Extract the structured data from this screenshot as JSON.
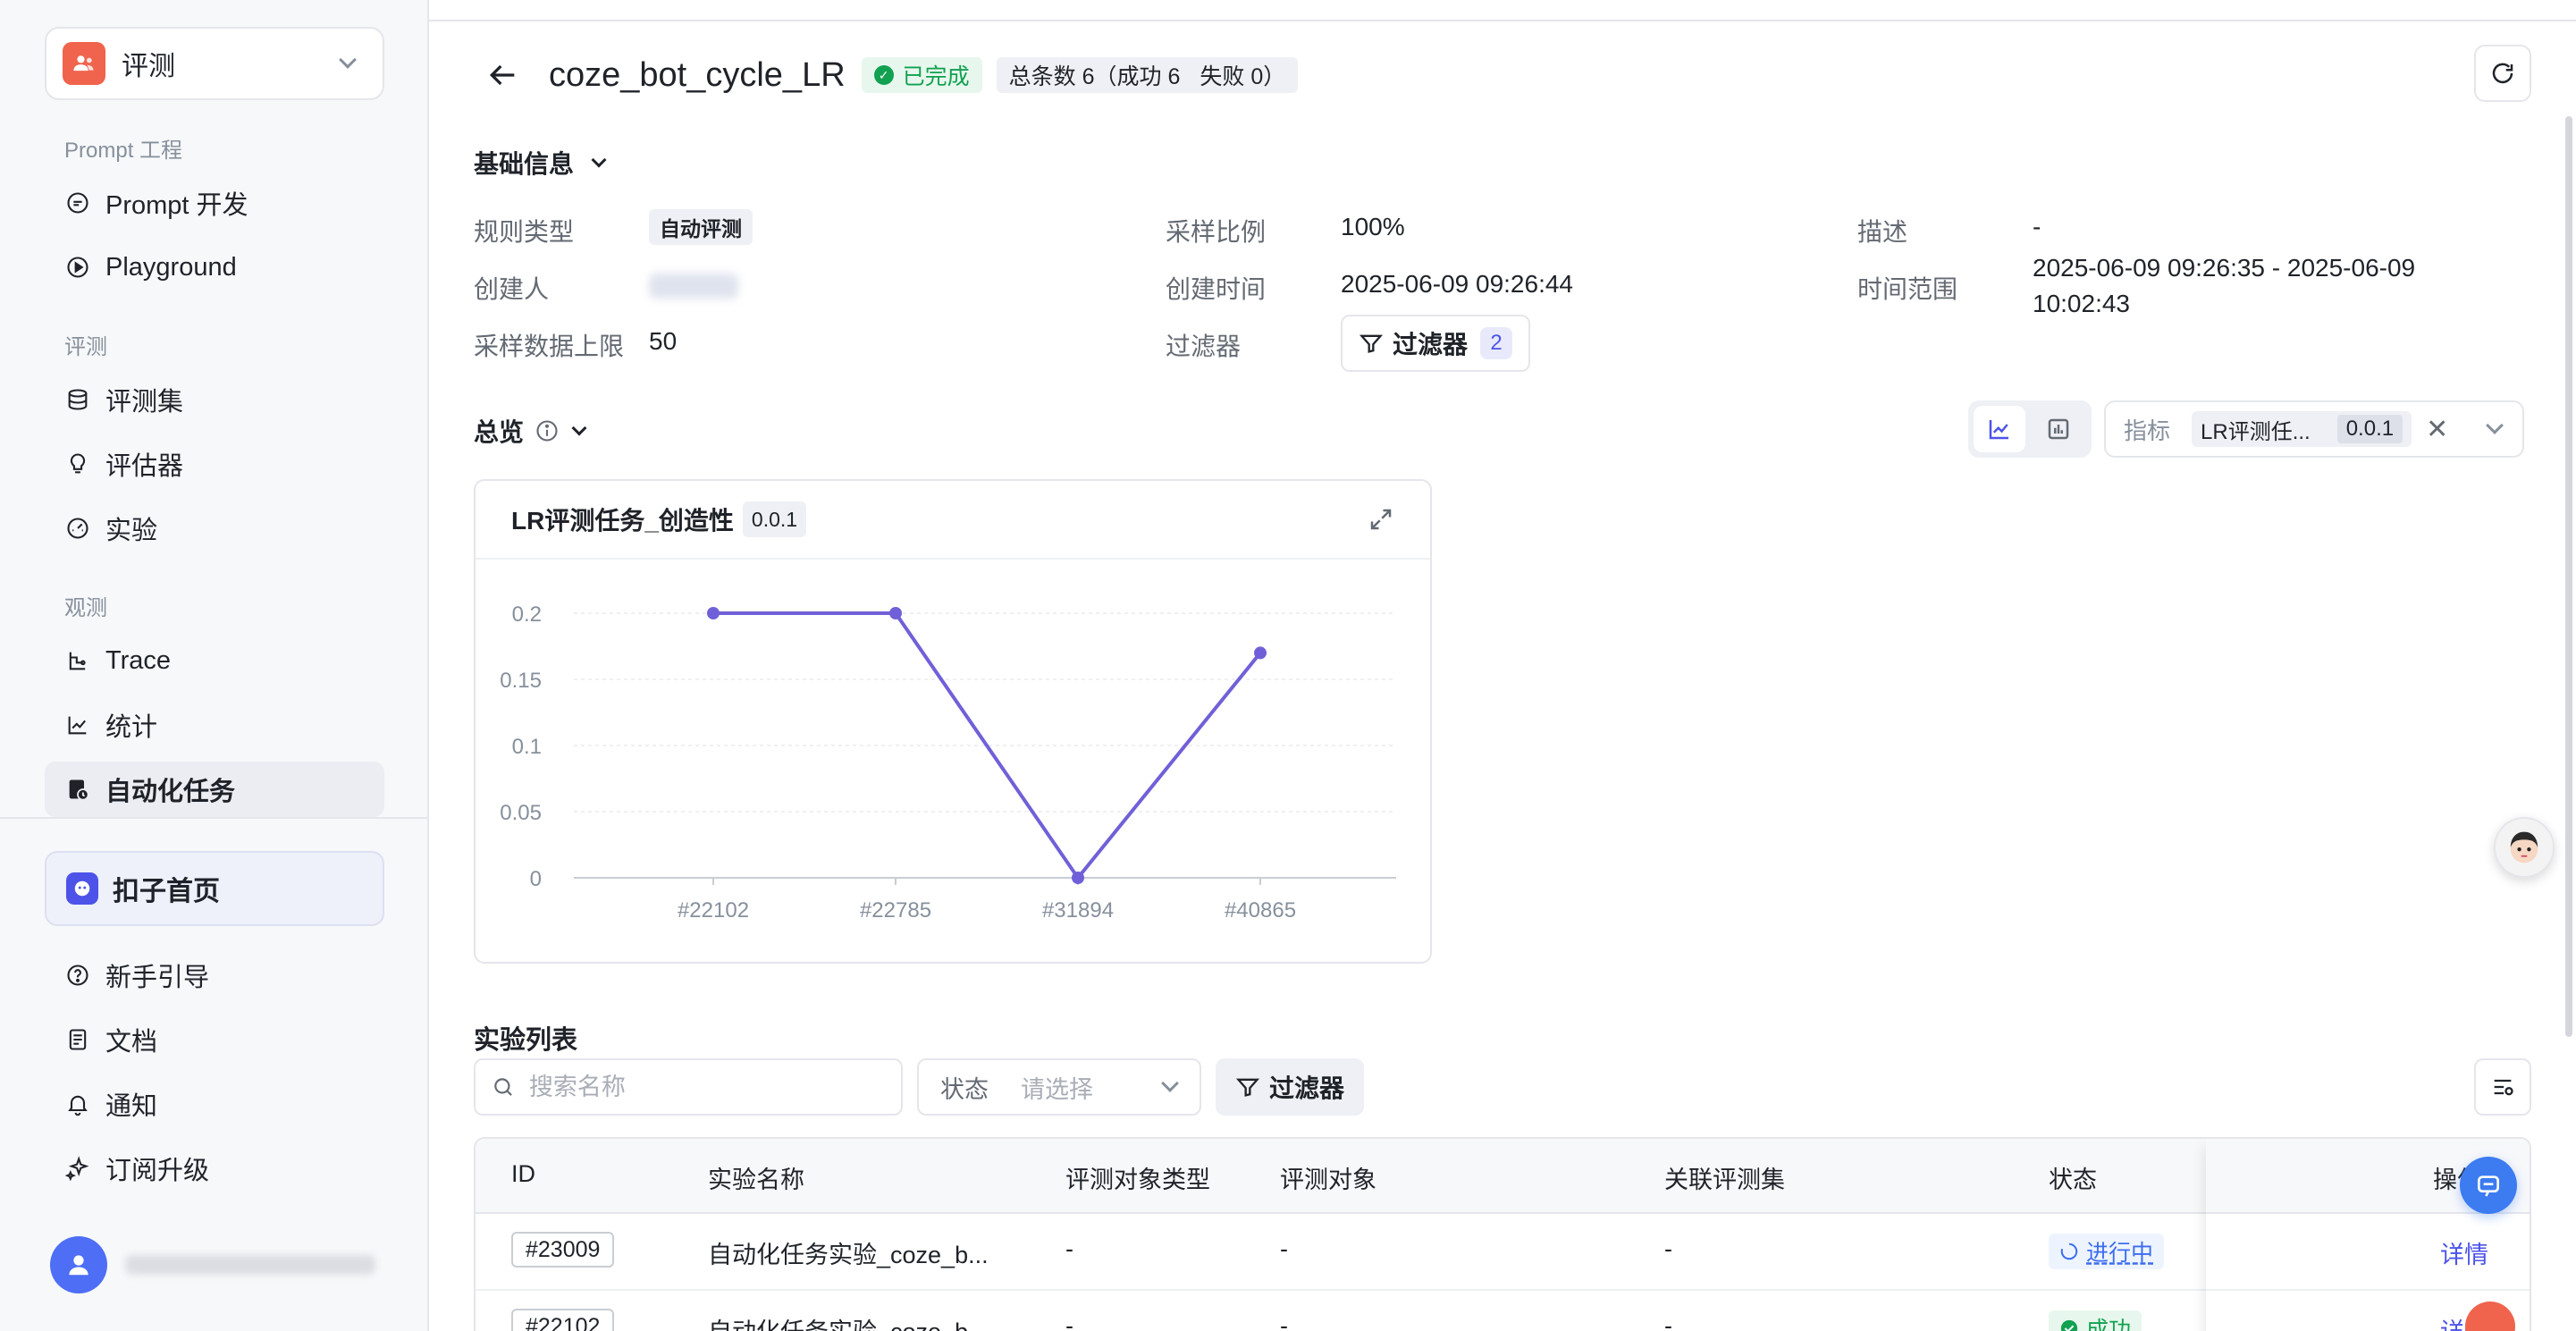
{
  "sidebar": {
    "workspace": {
      "label": "评测"
    },
    "groups": [
      {
        "title": "Prompt 工程"
      },
      {
        "title": "评测"
      },
      {
        "title": "观测"
      }
    ],
    "items": [
      {
        "label": "Prompt 开发",
        "icon": "chat-bubble-icon"
      },
      {
        "label": "Playground",
        "icon": "play-circle-icon"
      },
      {
        "label": "评测集",
        "icon": "database-icon"
      },
      {
        "label": "评估器",
        "icon": "lightbulb-icon"
      },
      {
        "label": "实验",
        "icon": "gauge-icon"
      },
      {
        "label": "Trace",
        "icon": "trace-icon"
      },
      {
        "label": "统计",
        "icon": "chart-icon"
      },
      {
        "label": "自动化任务",
        "icon": "task-icon"
      }
    ],
    "home": {
      "label": "扣子首页"
    },
    "bottom_items": [
      {
        "label": "新手引导",
        "icon": "help-circle-icon"
      },
      {
        "label": "文档",
        "icon": "document-icon"
      },
      {
        "label": "通知",
        "icon": "bell-icon"
      },
      {
        "label": "订阅升级",
        "icon": "sparkle-icon"
      }
    ]
  },
  "header": {
    "title": "coze_bot_cycle_LR",
    "status": "已完成",
    "total": "总条数 6（成功 6",
    "failed": "失败 0）"
  },
  "basic_info": {
    "title": "基础信息",
    "fields": {
      "rule_type_label": "规则类型",
      "rule_type_value": "自动评测",
      "creator_label": "创建人",
      "limit_label": "采样数据上限",
      "limit_value": "50",
      "ratio_label": "采样比例",
      "ratio_value": "100%",
      "created_label": "创建时间",
      "created_value": "2025-06-09 09:26:44",
      "filter_label": "过滤器",
      "filter_btn": "过滤器",
      "filter_count": "2",
      "desc_label": "描述",
      "desc_value": "-",
      "range_label": "时间范围",
      "range_line1": "2025-06-09 09:26:35 - 2025-06-09",
      "range_line2": "10:02:43"
    }
  },
  "overview": {
    "title": "总览",
    "metric_label": "指标",
    "metric_chip": "LR评测任...",
    "metric_version": "0.0.1"
  },
  "chart_card": {
    "title": "LR评测任务_创造性",
    "version": "0.0.1"
  },
  "chart_data": {
    "type": "line",
    "title": "LR评测任务_创造性",
    "categories": [
      "#22102",
      "#22785",
      "#31894",
      "#40865"
    ],
    "values": [
      0.2,
      0.2,
      0,
      0.17
    ],
    "yticks": [
      "0",
      "0.05",
      "0.1",
      "0.15",
      "0.2"
    ],
    "ylim": [
      0,
      0.2
    ],
    "grid": true,
    "color": "#7060d8"
  },
  "list": {
    "title": "实验列表",
    "search_placeholder": "搜索名称",
    "status_label": "状态",
    "status_placeholder": "请选择",
    "filter_btn": "过滤器",
    "columns": [
      "ID",
      "实验名称",
      "评测对象类型",
      "评测对象",
      "关联评测集",
      "状态",
      "操作"
    ],
    "rows": [
      {
        "id": "#23009",
        "name": "自动化任务实验_coze_b...",
        "type": "-",
        "target": "-",
        "dataset": "-",
        "status": "进行中",
        "action": "详情"
      },
      {
        "id": "#22102",
        "name": "自动化任务实验_coze_b...",
        "type": "-",
        "target": "-",
        "dataset": "-",
        "status": "成功",
        "action": "详情"
      }
    ]
  }
}
